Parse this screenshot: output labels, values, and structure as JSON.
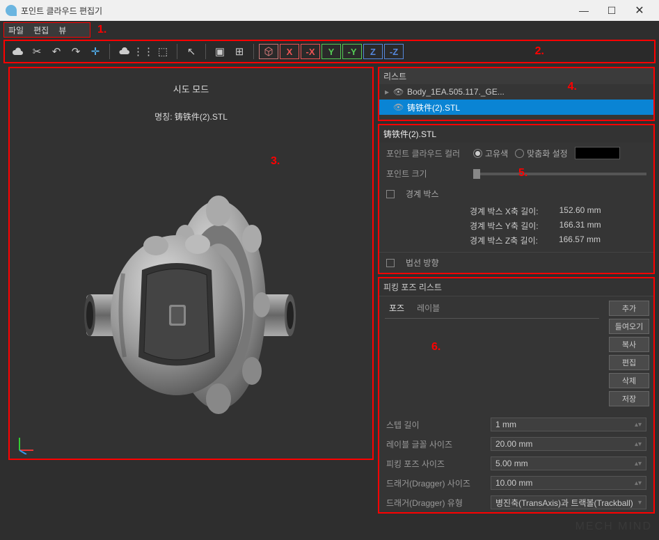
{
  "window": {
    "title": "포인트 클라우드 편집기"
  },
  "menu": {
    "file": "파일",
    "edit": "편집",
    "view": "뷰"
  },
  "annotations": {
    "a1": "1.",
    "a2": "2.",
    "a3": "3.",
    "a4": "4.",
    "a5": "5.",
    "a6": "6."
  },
  "axis_buttons": {
    "cube": "◫",
    "x": "X",
    "nx": "-X",
    "y": "Y",
    "ny": "-Y",
    "z": "Z",
    "nz": "-Z"
  },
  "viewport": {
    "mode": "시도 모드",
    "name_label": "명칭: 铸铁件(2).STL"
  },
  "list": {
    "header": "리스트",
    "items": [
      {
        "label": "Body_1EA.505.117._GE...",
        "selected": false
      },
      {
        "label": "铸铁件(2).STL",
        "selected": true
      }
    ]
  },
  "props": {
    "header": "铸铁件(2).STL",
    "color_label": "포인트 클라우드 컬러",
    "radio_unique": "고유색",
    "radio_custom": "맞춤화 설정",
    "size_label": "포인트 크기",
    "bbox_check": "경계 박스",
    "bbox_x_label": "경계 박스 X축 길이:",
    "bbox_x_val": "152.60  mm",
    "bbox_y_label": "경계 박스 Y축 길이:",
    "bbox_y_val": "166.31  mm",
    "bbox_z_label": "경계 박스 Z축 길이:",
    "bbox_z_val": "166.57  mm",
    "normal_check": "법선 방향"
  },
  "pose": {
    "header": "피킹 포즈 리스트",
    "tab_pose": "포즈",
    "tab_label": "레이블",
    "btn_add": "추가",
    "btn_import": "들여오기",
    "btn_copy": "복사",
    "btn_edit": "편집",
    "btn_delete": "삭제",
    "btn_save": "저장"
  },
  "settings": {
    "step_label": "스텝 길이",
    "step_val": "1 mm",
    "font_label": "레이블 글꼴 사이즈",
    "font_val": "20.00 mm",
    "pose_label": "피킹 포즈 사이즈",
    "pose_val": "5.00 mm",
    "drag_size_label": "드래거(Dragger) 사이즈",
    "drag_size_val": "10.00 mm",
    "drag_type_label": "드래거(Dragger) 유형",
    "drag_type_val": "병진축(TransAxis)과 트랙볼(Trackball)"
  },
  "watermark": "MECH MIND"
}
